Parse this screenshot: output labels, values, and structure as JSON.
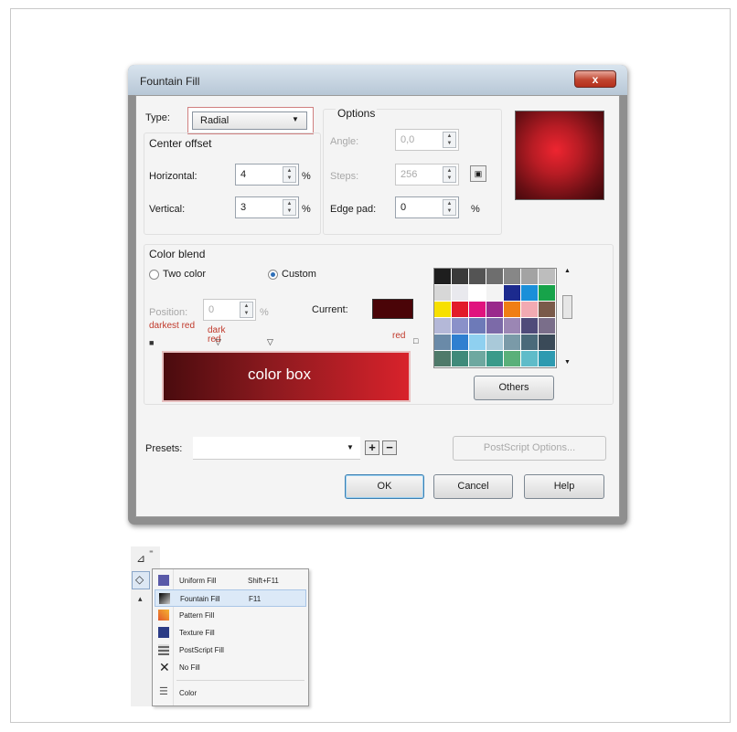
{
  "dialog": {
    "title": "Fountain Fill",
    "close_label": "x",
    "type": {
      "label": "Type:",
      "value": "Radial"
    },
    "center_offset": {
      "title": "Center offset",
      "horizontal": {
        "label": "Horizontal:",
        "value": "4",
        "unit": "%"
      },
      "vertical": {
        "label": "Vertical:",
        "value": "3",
        "unit": "%"
      }
    },
    "options": {
      "title": "Options",
      "angle": {
        "label": "Angle:",
        "value": "0,0"
      },
      "steps": {
        "label": "Steps:",
        "value": "256"
      },
      "edge_pad": {
        "label": "Edge pad:",
        "value": "0",
        "unit": "%"
      }
    },
    "color_blend": {
      "title": "Color blend",
      "two_color": "Two color",
      "custom": "Custom",
      "selected": "Custom",
      "position": {
        "label": "Position:",
        "value": "0",
        "unit": "%"
      },
      "current_label": "Current:",
      "current_color": "#4a0408",
      "stop_labels": [
        "darkest red",
        "dark red",
        "red"
      ],
      "color_box_label": "color box",
      "gradient": [
        "#4a0b0e",
        "#8e1a1f",
        "#d8222b"
      ],
      "palette": [
        [
          "#1e1e1e",
          "#3a3a3a",
          "#545454",
          "#6e6e6e",
          "#878787",
          "#a3a3a3",
          "#bdbdbd"
        ],
        [
          "#d7d7d7",
          "#e9e9ee",
          "#ffffff",
          "#f3f3f3",
          "#1c2a8e",
          "#1a8fd9",
          "#17a34a"
        ],
        [
          "#f7e000",
          "#e21b2a",
          "#e0137e",
          "#9a2a8c",
          "#f07e14",
          "#f2aab2",
          "#7a5a4a"
        ],
        [
          "#b4b8d8",
          "#8a91c9",
          "#6d7ab8",
          "#7c6aa8",
          "#9b86b4",
          "#4f4b7a",
          "#7a6e8a"
        ],
        [
          "#6a8aa8",
          "#2f7fd0",
          "#8fd0f0",
          "#a9c9d9",
          "#7a9aa8",
          "#4a6a7a",
          "#3a4a58"
        ],
        [
          "#4f7a6a",
          "#3f8a7a",
          "#6ea8a0",
          "#3a9a8a",
          "#5ab07a",
          "#5fbcc9",
          "#2e9ab0"
        ]
      ],
      "others_label": "Others"
    },
    "presets": {
      "label": "Presets:",
      "value": ""
    },
    "postscript_options": "PostScript Options...",
    "buttons": {
      "ok": "OK",
      "cancel": "Cancel",
      "help": "Help"
    }
  },
  "fill_menu": {
    "items": [
      {
        "label": "Uniform Fill",
        "shortcut": "Shift+F11",
        "icon": "uniform-fill-icon"
      },
      {
        "label": "Fountain Fill",
        "shortcut": "F11",
        "icon": "fountain-fill-icon"
      },
      {
        "label": "Pattern Fill",
        "shortcut": "",
        "icon": "pattern-fill-icon"
      },
      {
        "label": "Texture Fill",
        "shortcut": "",
        "icon": "texture-fill-icon"
      },
      {
        "label": "PostScript Fill",
        "shortcut": "",
        "icon": "postscript-fill-icon"
      },
      {
        "label": "No Fill",
        "shortcut": "",
        "icon": "no-fill-icon"
      },
      {
        "label": "Color",
        "shortcut": "",
        "icon": "color-icon"
      }
    ],
    "highlighted": "Fountain Fill"
  }
}
